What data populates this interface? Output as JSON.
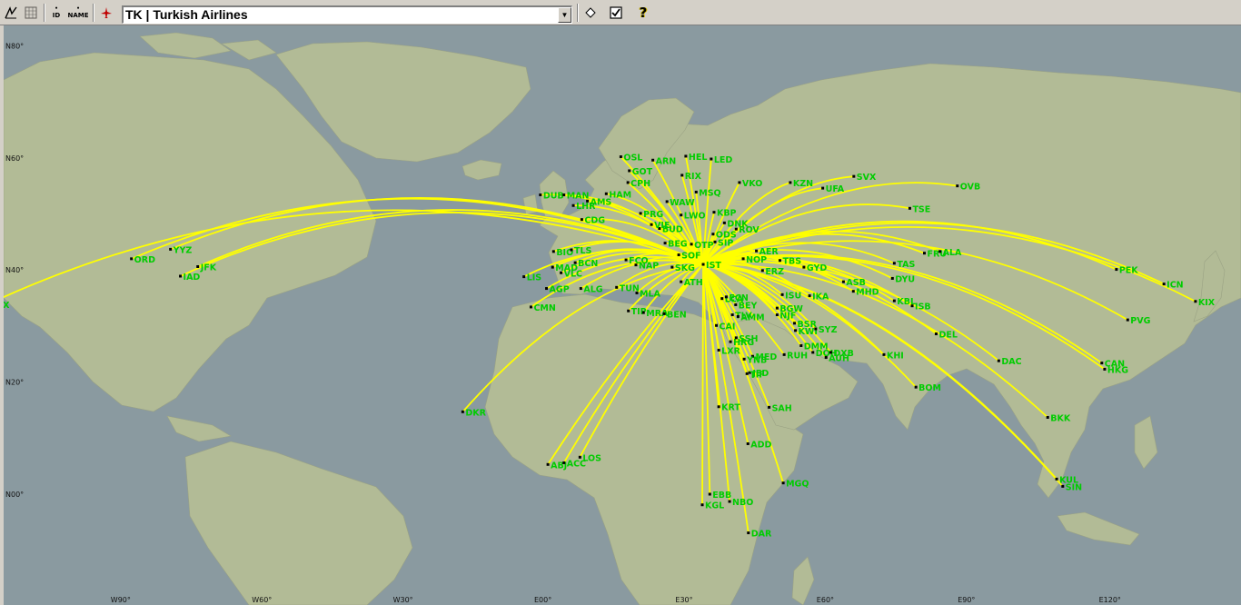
{
  "toolbar": {
    "airline_value": "TK | Turkish Airlines",
    "btn_id": "ID",
    "btn_name": "NAME",
    "btn_help": "?"
  },
  "map": {
    "colors": {
      "ocean": "#8a9aa0",
      "land": "#b2bb96",
      "route": "#ffff00",
      "label": "#00cc00"
    },
    "hub": "IST",
    "lat_labels": [
      "N80°",
      "N60°",
      "N40°",
      "N20°",
      "N00°"
    ],
    "lon_labels": [
      "W90°",
      "W60°",
      "W30°",
      "E00°",
      "E30°",
      "E60°",
      "E90°",
      "E120°"
    ],
    "airports": [
      {
        "code": "LAX",
        "lon": -118.4,
        "lat": 33.9
      },
      {
        "code": "ORD",
        "lon": -87.9,
        "lat": 42.0
      },
      {
        "code": "YYZ",
        "lon": -79.6,
        "lat": 43.7
      },
      {
        "code": "JFK",
        "lon": -73.8,
        "lat": 40.6
      },
      {
        "code": "IAD",
        "lon": -77.5,
        "lat": 38.9
      },
      {
        "code": "DKR",
        "lon": -17.5,
        "lat": 14.7
      },
      {
        "code": "ABJ",
        "lon": 0.6,
        "lat": 5.3
      },
      {
        "code": "ACC",
        "lon": 4.0,
        "lat": 5.6
      },
      {
        "code": "LOS",
        "lon": 7.4,
        "lat": 6.6
      },
      {
        "code": "CMN",
        "lon": -3.0,
        "lat": 33.4
      },
      {
        "code": "LIS",
        "lon": -4.5,
        "lat": 38.8
      },
      {
        "code": "MAD",
        "lon": 1.6,
        "lat": 40.5
      },
      {
        "code": "VLC",
        "lon": 3.4,
        "lat": 39.5
      },
      {
        "code": "BCN",
        "lon": 6.4,
        "lat": 41.3
      },
      {
        "code": "BIO",
        "lon": 1.8,
        "lat": 43.3
      },
      {
        "code": "TLS",
        "lon": 5.6,
        "lat": 43.6
      },
      {
        "code": "AGP",
        "lon": 0.3,
        "lat": 36.7
      },
      {
        "code": "ALG",
        "lon": 7.6,
        "lat": 36.7
      },
      {
        "code": "TUN",
        "lon": 15.2,
        "lat": 36.9
      },
      {
        "code": "MLA",
        "lon": 19.5,
        "lat": 35.9
      },
      {
        "code": "TIP",
        "lon": 17.7,
        "lat": 32.7
      },
      {
        "code": "MRA",
        "lon": 20.9,
        "lat": 32.4
      },
      {
        "code": "BEN",
        "lon": 25.3,
        "lat": 32.2
      },
      {
        "code": "DUB",
        "lon": -1.0,
        "lat": 53.4
      },
      {
        "code": "MAN",
        "lon": 4.0,
        "lat": 53.4
      },
      {
        "code": "LHR",
        "lon": 6.0,
        "lat": 51.5
      },
      {
        "code": "CDG",
        "lon": 7.8,
        "lat": 49.0
      },
      {
        "code": "AMS",
        "lon": 9.0,
        "lat": 52.3
      },
      {
        "code": "HAM",
        "lon": 13.0,
        "lat": 53.6
      },
      {
        "code": "CPH",
        "lon": 17.6,
        "lat": 55.6
      },
      {
        "code": "GOT",
        "lon": 17.9,
        "lat": 57.7
      },
      {
        "code": "OSL",
        "lon": 16.1,
        "lat": 60.2
      },
      {
        "code": "ARN",
        "lon": 22.9,
        "lat": 59.6
      },
      {
        "code": "HEL",
        "lon": 29.9,
        "lat": 60.3
      },
      {
        "code": "RIX",
        "lon": 29.1,
        "lat": 56.9
      },
      {
        "code": "LED",
        "lon": 35.3,
        "lat": 59.8
      },
      {
        "code": "WAW",
        "lon": 25.9,
        "lat": 52.2
      },
      {
        "code": "MSQ",
        "lon": 32.1,
        "lat": 53.9
      },
      {
        "code": "VKO",
        "lon": 41.3,
        "lat": 55.6
      },
      {
        "code": "KZN",
        "lon": 52.1,
        "lat": 55.6
      },
      {
        "code": "UFA",
        "lon": 59.0,
        "lat": 54.6
      },
      {
        "code": "SVX",
        "lon": 65.6,
        "lat": 56.7
      },
      {
        "code": "OVB",
        "lon": 87.6,
        "lat": 55.0
      },
      {
        "code": "TSE",
        "lon": 77.5,
        "lat": 51.0
      },
      {
        "code": "LWO",
        "lon": 28.9,
        "lat": 49.8
      },
      {
        "code": "KBP",
        "lon": 35.9,
        "lat": 50.3
      },
      {
        "code": "DNK",
        "lon": 38.1,
        "lat": 48.4
      },
      {
        "code": "ROV",
        "lon": 40.6,
        "lat": 47.3
      },
      {
        "code": "ODS",
        "lon": 35.7,
        "lat": 46.4
      },
      {
        "code": "SIP",
        "lon": 36.1,
        "lat": 45.0
      },
      {
        "code": "OTP",
        "lon": 31.1,
        "lat": 44.6
      },
      {
        "code": "BUD",
        "lon": 24.3,
        "lat": 47.4
      },
      {
        "code": "VIE",
        "lon": 22.6,
        "lat": 48.1
      },
      {
        "code": "PRG",
        "lon": 20.3,
        "lat": 50.1
      },
      {
        "code": "BEG",
        "lon": 25.5,
        "lat": 44.8
      },
      {
        "code": "SOF",
        "lon": 28.4,
        "lat": 42.7
      },
      {
        "code": "SKG",
        "lon": 27.0,
        "lat": 40.5
      },
      {
        "code": "IST",
        "lon": 33.6,
        "lat": 41.0
      },
      {
        "code": "NAP",
        "lon": 19.3,
        "lat": 40.9
      },
      {
        "code": "FCO",
        "lon": 17.2,
        "lat": 41.8
      },
      {
        "code": "ATH",
        "lon": 28.9,
        "lat": 37.9
      },
      {
        "code": "LCA",
        "lon": 37.6,
        "lat": 34.9
      },
      {
        "code": "TLV",
        "lon": 39.8,
        "lat": 32.0
      },
      {
        "code": "AMM",
        "lon": 41.0,
        "lat": 31.7
      },
      {
        "code": "CAI",
        "lon": 36.4,
        "lat": 30.1
      },
      {
        "code": "BEY",
        "lon": 40.5,
        "lat": 33.8
      },
      {
        "code": "ECN",
        "lon": 38.5,
        "lat": 35.2
      },
      {
        "code": "NJF",
        "lon": 49.3,
        "lat": 32.0
      },
      {
        "code": "BGW",
        "lon": 49.3,
        "lat": 33.2
      },
      {
        "code": "ISU",
        "lon": 50.4,
        "lat": 35.6
      },
      {
        "code": "IKA",
        "lon": 56.2,
        "lat": 35.4
      },
      {
        "code": "GYD",
        "lon": 55.0,
        "lat": 40.5
      },
      {
        "code": "TBS",
        "lon": 49.9,
        "lat": 41.7
      },
      {
        "code": "ERZ",
        "lon": 46.2,
        "lat": 39.9
      },
      {
        "code": "NOP",
        "lon": 42.1,
        "lat": 42.0
      },
      {
        "code": "AER",
        "lon": 44.9,
        "lat": 43.4
      },
      {
        "code": "ASB",
        "lon": 63.4,
        "lat": 37.9
      },
      {
        "code": "MHD",
        "lon": 65.5,
        "lat": 36.2
      },
      {
        "code": "TAS",
        "lon": 74.2,
        "lat": 41.2
      },
      {
        "code": "DYU",
        "lon": 73.8,
        "lat": 38.5
      },
      {
        "code": "FRU",
        "lon": 80.6,
        "lat": 43.0
      },
      {
        "code": "ALA",
        "lon": 83.9,
        "lat": 43.3
      },
      {
        "code": "KBL",
        "lon": 74.2,
        "lat": 34.5
      },
      {
        "code": "ISB",
        "lon": 78.0,
        "lat": 33.6
      },
      {
        "code": "DEL",
        "lon": 83.1,
        "lat": 28.6
      },
      {
        "code": "BOM",
        "lon": 78.8,
        "lat": 19.1
      },
      {
        "code": "KHI",
        "lon": 72.0,
        "lat": 24.9
      },
      {
        "code": "DAC",
        "lon": 96.4,
        "lat": 23.8
      },
      {
        "code": "BKK",
        "lon": 106.8,
        "lat": 13.7
      },
      {
        "code": "KUL",
        "lon": 108.7,
        "lat": 2.7
      },
      {
        "code": "SIN",
        "lon": 110.0,
        "lat": 1.4
      },
      {
        "code": "CAN",
        "lon": 118.3,
        "lat": 23.4
      },
      {
        "code": "HKG",
        "lon": 118.9,
        "lat": 22.3
      },
      {
        "code": "PVG",
        "lon": 123.8,
        "lat": 31.1
      },
      {
        "code": "PEK",
        "lon": 121.4,
        "lat": 40.1
      },
      {
        "code": "ICN",
        "lon": 131.5,
        "lat": 37.5
      },
      {
        "code": "KIX",
        "lon": 138.2,
        "lat": 34.4
      },
      {
        "code": "KWI",
        "lon": 53.2,
        "lat": 29.2
      },
      {
        "code": "BSR",
        "lon": 53.0,
        "lat": 30.5
      },
      {
        "code": "SYZ",
        "lon": 57.5,
        "lat": 29.5
      },
      {
        "code": "DMM",
        "lon": 54.4,
        "lat": 26.5
      },
      {
        "code": "DOH",
        "lon": 56.9,
        "lat": 25.3
      },
      {
        "code": "DXB",
        "lon": 60.7,
        "lat": 25.3
      },
      {
        "code": "AUH",
        "lon": 59.7,
        "lat": 24.4
      },
      {
        "code": "RUH",
        "lon": 50.8,
        "lat": 24.9
      },
      {
        "code": "MED",
        "lon": 44.1,
        "lat": 24.6
      },
      {
        "code": "YNB",
        "lon": 42.3,
        "lat": 24.1
      },
      {
        "code": "JED",
        "lon": 43.5,
        "lat": 21.7
      },
      {
        "code": "TIF",
        "lon": 42.9,
        "lat": 21.5
      },
      {
        "code": "SAH",
        "lon": 47.6,
        "lat": 15.5
      },
      {
        "code": "KRT",
        "lon": 36.9,
        "lat": 15.6
      },
      {
        "code": "ADD",
        "lon": 43.1,
        "lat": 9.0
      },
      {
        "code": "MGQ",
        "lon": 50.6,
        "lat": 2.0
      },
      {
        "code": "EBB",
        "lon": 35.0,
        "lat": 0.0
      },
      {
        "code": "NBO",
        "lon": 39.2,
        "lat": -1.3
      },
      {
        "code": "KGL",
        "lon": 33.4,
        "lat": -1.9
      },
      {
        "code": "DAR",
        "lon": 43.2,
        "lat": -6.9
      },
      {
        "code": "LXR",
        "lon": 36.9,
        "lat": 25.7
      },
      {
        "code": "HRG",
        "lon": 39.4,
        "lat": 27.2
      },
      {
        "code": "SSH",
        "lon": 40.6,
        "lat": 27.9
      }
    ]
  }
}
